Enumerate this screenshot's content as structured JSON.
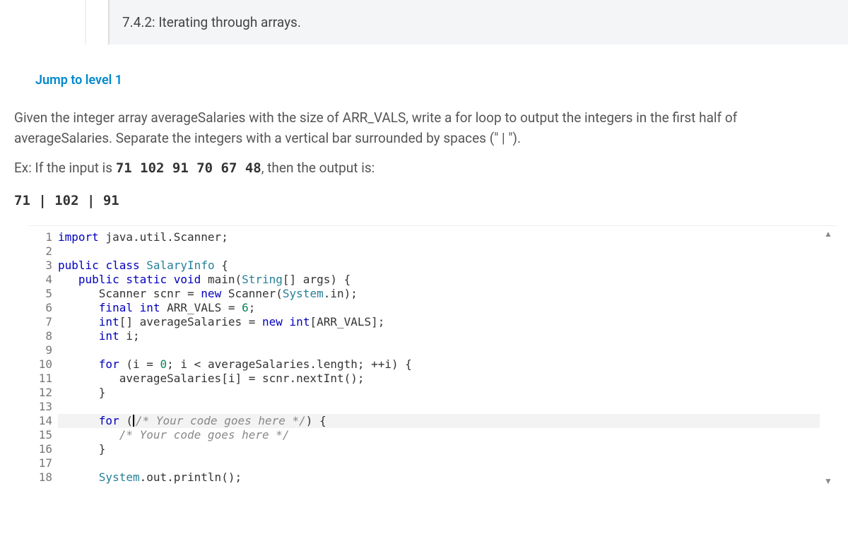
{
  "header": {
    "title": "7.4.2: Iterating through arrays."
  },
  "jump_link": "Jump to level 1",
  "prompt": {
    "p1a": "Given the integer array averageSalaries with the size of ARR_VALS, write a for loop to output the integers in the first half of averageSalaries. Separate the integers with a vertical bar surrounded by spaces (\" | \").",
    "ex_prefix": "Ex: If the input is ",
    "ex_input": "71 102 91 70 67 48",
    "ex_suffix": ", then the output is:",
    "ex_output": "71 | 102 | 91"
  },
  "code": {
    "line_count": 18,
    "lines": {
      "l1_a": "import",
      "l1_b": " java.util.Scanner;",
      "l2": "",
      "l3_a": "public",
      "l3_b": " ",
      "l3_c": "class",
      "l3_d": " ",
      "l3_e": "SalaryInfo",
      "l3_f": " {",
      "l4_a": "   ",
      "l4_b": "public",
      "l4_c": " ",
      "l4_d": "static",
      "l4_e": " ",
      "l4_f": "void",
      "l4_g": " main(",
      "l4_h": "String",
      "l4_i": "[] args) {",
      "l5_a": "      Scanner scnr = ",
      "l5_b": "new",
      "l5_c": " Scanner(",
      "l5_d": "System",
      "l5_e": ".in);",
      "l6_a": "      ",
      "l6_b": "final",
      "l6_c": " ",
      "l6_d": "int",
      "l6_e": " ARR_VALS = ",
      "l6_f": "6",
      "l6_g": ";",
      "l7_a": "      ",
      "l7_b": "int",
      "l7_c": "[] averageSalaries = ",
      "l7_d": "new",
      "l7_e": " ",
      "l7_f": "int",
      "l7_g": "[ARR_VALS];",
      "l8_a": "      ",
      "l8_b": "int",
      "l8_c": " i;",
      "l9": "",
      "l10_a": "      ",
      "l10_b": "for",
      "l10_c": " (i = ",
      "l10_d": "0",
      "l10_e": "; i < averageSalaries.length; ++i) {",
      "l11": "         averageSalaries[i] = scnr.nextInt();",
      "l12": "      }",
      "l13": "",
      "l14_a": "      ",
      "l14_b": "for",
      "l14_c": " (",
      "l14_d": "/* Your code goes here */",
      "l14_e": ") {",
      "l15_a": "         ",
      "l15_b": "/* Your code goes here */",
      "l16": "      }",
      "l17": "",
      "l18_a": "      ",
      "l18_b": "System",
      "l18_c": ".out.println();"
    }
  },
  "scroll": {
    "up": "▲",
    "down": "▼"
  }
}
